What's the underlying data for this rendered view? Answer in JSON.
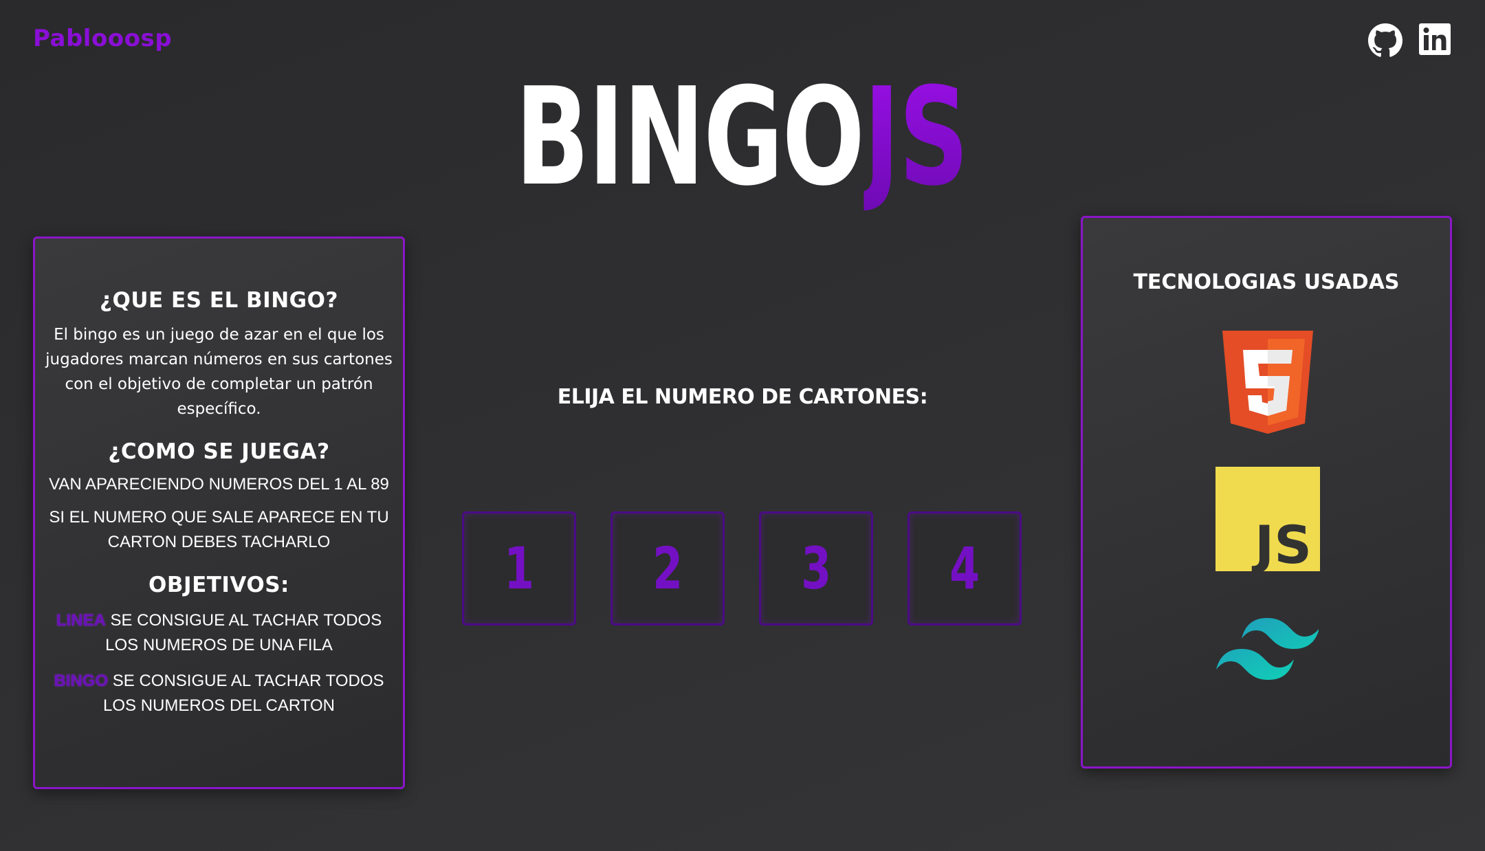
{
  "header": {
    "brand": "Pablooosp",
    "social": [
      {
        "name": "github",
        "icon": "github-icon"
      },
      {
        "name": "linkedin",
        "icon": "linkedin-icon"
      }
    ]
  },
  "title": {
    "white": "BINGO",
    "accent": "JS"
  },
  "info_panel": {
    "what_heading": "¿QUE ES EL BINGO?",
    "what_text": "El bingo es un juego de azar en el que los jugadores marcan números en sus cartones con el objetivo de completar un patrón específico.",
    "how_heading": "¿COMO SE JUEGA?",
    "rule_1": "VAN APARECIENDO NUMEROS DEL 1 AL 89",
    "rule_2": "SI EL NUMERO QUE SALE APARECE EN TU CARTON DEBES TACHARLO",
    "objectives_heading": "OBJETIVOS:",
    "objective_1_keyword": "LINEA",
    "objective_1_text": " SE CONSIGUE AL TACHAR TODOS LOS NUMEROS DE UNA FILA",
    "objective_2_keyword": "BINGO",
    "objective_2_text": " SE CONSIGUE AL TACHAR TODOS LOS NUMEROS DEL CARTON"
  },
  "selector": {
    "prompt": "ELIJA EL NUMERO DE CARTONES:",
    "options": [
      "1",
      "2",
      "3",
      "4"
    ]
  },
  "tech_panel": {
    "heading": "TECNOLOGIAS USADAS",
    "logos": [
      "html5-icon",
      "javascript-icon",
      "tailwind-icon"
    ],
    "js_label": "JS"
  },
  "colors": {
    "accent": "#8a16c8",
    "button_text": "#7410c4",
    "html5": "#e44d26",
    "js": "#f0db4f",
    "tailwind": "#38bdf8"
  }
}
